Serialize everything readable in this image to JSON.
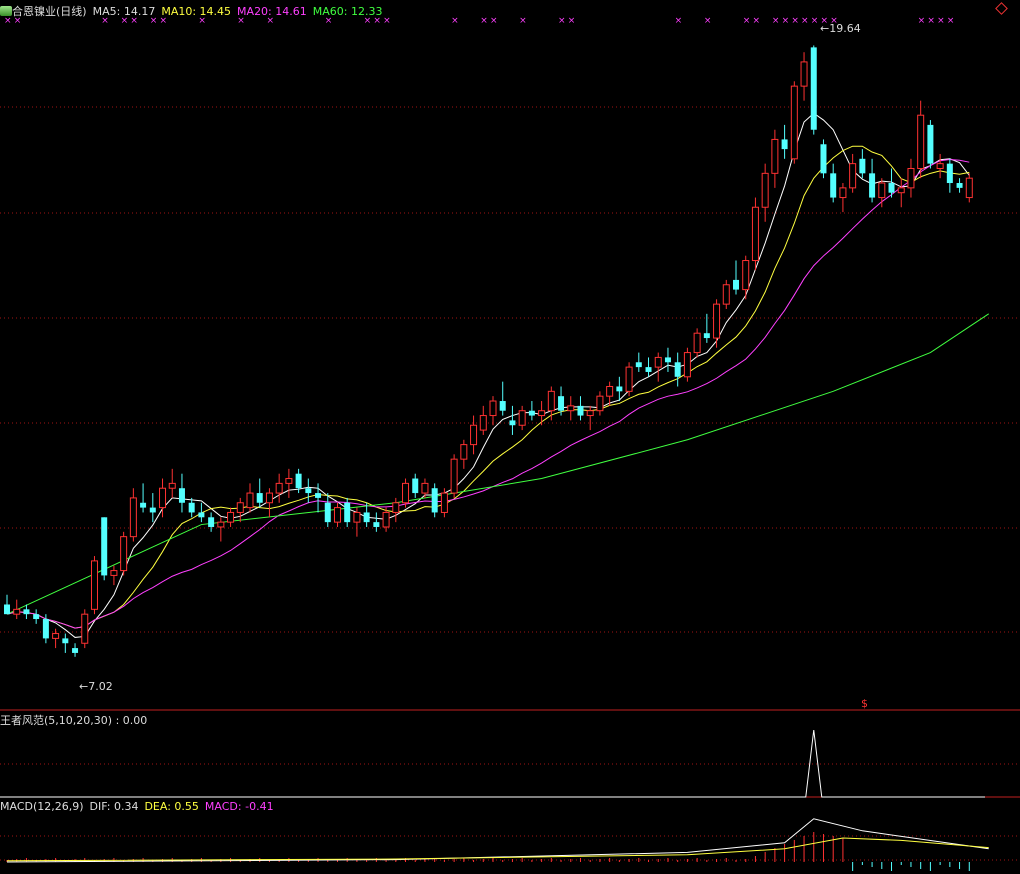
{
  "main": {
    "title": "合恩镍业(日线)",
    "ma5": {
      "label": "MA5:",
      "value": "14.17",
      "color": "#ffffff"
    },
    "ma10": {
      "label": "MA10:",
      "value": "14.45",
      "color": "#ffff40"
    },
    "ma20": {
      "label": "MA20:",
      "value": "14.61",
      "color": "#ff40ff"
    },
    "ma60": {
      "label": "MA60:",
      "value": "12.33",
      "color": "#40ff40"
    },
    "high_label": "19.64",
    "low_label": "7.02",
    "signal_mark": "$"
  },
  "indicator": {
    "title": "王者风范(5,10,20,30)",
    "value": ": 0.00"
  },
  "macd": {
    "title": "MACD(12,26,9)",
    "dif_label": "DIF:",
    "dif": "0.34",
    "dif_color": "#ffffff",
    "dea_label": "DEA:",
    "dea": "0.55",
    "dea_color": "#ffff40",
    "macd_label": "MACD:",
    "macd": "-0.41",
    "macd_color": "#ff40ff"
  },
  "colors": {
    "up": "#ff3232",
    "down": "#54ffff",
    "grid": "#a01414",
    "cross": "#ff40ff"
  },
  "chart_data": {
    "type": "candlestick",
    "price_range": [
      6.5,
      20.0
    ],
    "ohlc": [
      [
        8.1,
        8.3,
        7.9,
        7.9
      ],
      [
        7.9,
        8.2,
        7.8,
        8.0
      ],
      [
        8.0,
        8.1,
        7.8,
        7.9
      ],
      [
        7.9,
        8.0,
        7.7,
        7.8
      ],
      [
        7.8,
        7.9,
        7.3,
        7.4
      ],
      [
        7.4,
        7.6,
        7.2,
        7.5
      ],
      [
        7.4,
        7.5,
        7.1,
        7.3
      ],
      [
        7.2,
        7.3,
        7.02,
        7.1
      ],
      [
        7.3,
        8.0,
        7.2,
        7.9
      ],
      [
        8.0,
        9.1,
        7.9,
        9.0
      ],
      [
        9.9,
        9.9,
        8.6,
        8.7
      ],
      [
        8.7,
        8.9,
        8.5,
        8.8
      ],
      [
        8.8,
        9.6,
        8.7,
        9.5
      ],
      [
        9.5,
        10.5,
        9.4,
        10.3
      ],
      [
        10.2,
        10.6,
        10.0,
        10.1
      ],
      [
        10.1,
        10.4,
        9.8,
        10.0
      ],
      [
        10.1,
        10.7,
        9.9,
        10.5
      ],
      [
        10.5,
        10.9,
        10.3,
        10.6
      ],
      [
        10.5,
        10.8,
        10.0,
        10.2
      ],
      [
        10.2,
        10.3,
        9.9,
        10.0
      ],
      [
        10.0,
        10.2,
        9.8,
        9.9
      ],
      [
        9.9,
        10.0,
        9.6,
        9.7
      ],
      [
        9.7,
        9.9,
        9.4,
        9.8
      ],
      [
        9.8,
        10.1,
        9.7,
        10.0
      ],
      [
        10.0,
        10.3,
        9.8,
        10.2
      ],
      [
        10.1,
        10.6,
        10.0,
        10.4
      ],
      [
        10.4,
        10.7,
        10.1,
        10.2
      ],
      [
        10.2,
        10.5,
        9.9,
        10.4
      ],
      [
        10.4,
        10.8,
        10.2,
        10.6
      ],
      [
        10.6,
        10.9,
        10.3,
        10.7
      ],
      [
        10.8,
        10.9,
        10.4,
        10.5
      ],
      [
        10.5,
        10.7,
        10.2,
        10.4
      ],
      [
        10.4,
        10.6,
        10.0,
        10.3
      ],
      [
        10.2,
        10.4,
        9.7,
        9.8
      ],
      [
        9.8,
        10.2,
        9.7,
        10.1
      ],
      [
        10.2,
        10.3,
        9.7,
        9.8
      ],
      [
        9.8,
        10.1,
        9.5,
        10.0
      ],
      [
        10.0,
        10.2,
        9.7,
        9.8
      ],
      [
        9.8,
        10.0,
        9.6,
        9.7
      ],
      [
        9.7,
        10.1,
        9.6,
        10.0
      ],
      [
        10.0,
        10.3,
        9.8,
        10.2
      ],
      [
        10.2,
        10.7,
        10.1,
        10.6
      ],
      [
        10.7,
        10.8,
        10.3,
        10.4
      ],
      [
        10.4,
        10.7,
        10.3,
        10.6
      ],
      [
        10.5,
        10.6,
        9.9,
        10.0
      ],
      [
        10.0,
        10.5,
        9.9,
        10.4
      ],
      [
        10.4,
        11.2,
        10.3,
        11.1
      ],
      [
        11.1,
        11.5,
        10.9,
        11.4
      ],
      [
        11.4,
        12.0,
        11.2,
        11.8
      ],
      [
        11.7,
        12.2,
        11.6,
        12.0
      ],
      [
        12.0,
        12.4,
        11.8,
        12.3
      ],
      [
        12.3,
        12.7,
        12.0,
        12.1
      ],
      [
        11.9,
        12.2,
        11.6,
        11.8
      ],
      [
        11.8,
        12.2,
        11.7,
        12.1
      ],
      [
        12.1,
        12.3,
        11.9,
        12.0
      ],
      [
        12.0,
        12.3,
        11.8,
        12.1
      ],
      [
        12.1,
        12.6,
        11.9,
        12.5
      ],
      [
        12.4,
        12.6,
        12.0,
        12.1
      ],
      [
        12.1,
        12.4,
        11.9,
        12.2
      ],
      [
        12.2,
        12.4,
        11.9,
        12.0
      ],
      [
        12.0,
        12.2,
        11.7,
        12.1
      ],
      [
        12.1,
        12.5,
        12.0,
        12.4
      ],
      [
        12.4,
        12.7,
        12.2,
        12.6
      ],
      [
        12.6,
        12.8,
        12.3,
        12.5
      ],
      [
        12.5,
        13.1,
        12.4,
        13.0
      ],
      [
        13.1,
        13.3,
        12.9,
        13.0
      ],
      [
        13.0,
        13.2,
        12.8,
        12.9
      ],
      [
        13.0,
        13.3,
        12.7,
        13.2
      ],
      [
        13.2,
        13.4,
        12.9,
        13.1
      ],
      [
        13.1,
        13.3,
        12.6,
        12.8
      ],
      [
        12.8,
        13.4,
        12.7,
        13.3
      ],
      [
        13.3,
        13.8,
        13.2,
        13.7
      ],
      [
        13.7,
        14.1,
        13.5,
        13.6
      ],
      [
        13.6,
        14.4,
        13.4,
        14.3
      ],
      [
        14.3,
        14.8,
        14.2,
        14.7
      ],
      [
        14.8,
        15.2,
        14.5,
        14.6
      ],
      [
        14.6,
        15.3,
        14.4,
        15.2
      ],
      [
        15.2,
        16.5,
        15.0,
        16.3
      ],
      [
        16.3,
        17.2,
        16.0,
        17.0
      ],
      [
        17.0,
        17.9,
        16.7,
        17.7
      ],
      [
        17.7,
        18.0,
        17.3,
        17.5
      ],
      [
        17.3,
        18.9,
        17.2,
        18.8
      ],
      [
        18.8,
        19.5,
        18.5,
        19.3
      ],
      [
        19.6,
        19.64,
        17.8,
        17.9
      ],
      [
        17.6,
        17.7,
        16.9,
        17.0
      ],
      [
        17.0,
        17.2,
        16.4,
        16.5
      ],
      [
        16.5,
        16.8,
        16.2,
        16.7
      ],
      [
        16.7,
        17.4,
        16.6,
        17.2
      ],
      [
        17.3,
        17.5,
        16.9,
        17.0
      ],
      [
        17.0,
        17.3,
        16.4,
        16.5
      ],
      [
        16.5,
        16.9,
        16.3,
        16.8
      ],
      [
        16.8,
        17.1,
        16.5,
        16.6
      ],
      [
        16.6,
        16.9,
        16.3,
        16.7
      ],
      [
        16.7,
        17.3,
        16.5,
        17.1
      ],
      [
        17.1,
        18.5,
        16.9,
        18.2
      ],
      [
        18.0,
        18.1,
        17.1,
        17.2
      ],
      [
        17.1,
        17.4,
        16.9,
        17.2
      ],
      [
        17.2,
        17.3,
        16.6,
        16.8
      ],
      [
        16.8,
        16.9,
        16.6,
        16.7
      ],
      [
        16.5,
        17.0,
        16.4,
        16.9
      ]
    ],
    "ma60_points": [
      [
        0,
        7.9
      ],
      [
        20,
        9.75
      ],
      [
        40,
        10.2
      ],
      [
        55,
        10.7
      ],
      [
        70,
        11.5
      ],
      [
        85,
        12.5
      ],
      [
        95,
        13.3
      ],
      [
        101,
        14.1
      ]
    ],
    "indicator_series": {
      "peak_index": 83,
      "baseline": 0,
      "peak": 1
    },
    "macd_series": {
      "dif": [
        [
          0,
          0
        ],
        [
          40,
          0.2
        ],
        [
          70,
          0.8
        ],
        [
          80,
          1.6
        ],
        [
          83,
          3.6
        ],
        [
          88,
          2.6
        ],
        [
          101,
          1.1
        ]
      ],
      "dea": [
        [
          0,
          0.1
        ],
        [
          40,
          0.25
        ],
        [
          70,
          0.6
        ],
        [
          80,
          1.1
        ],
        [
          86,
          2.0
        ],
        [
          92,
          1.8
        ],
        [
          101,
          1.2
        ]
      ]
    }
  }
}
